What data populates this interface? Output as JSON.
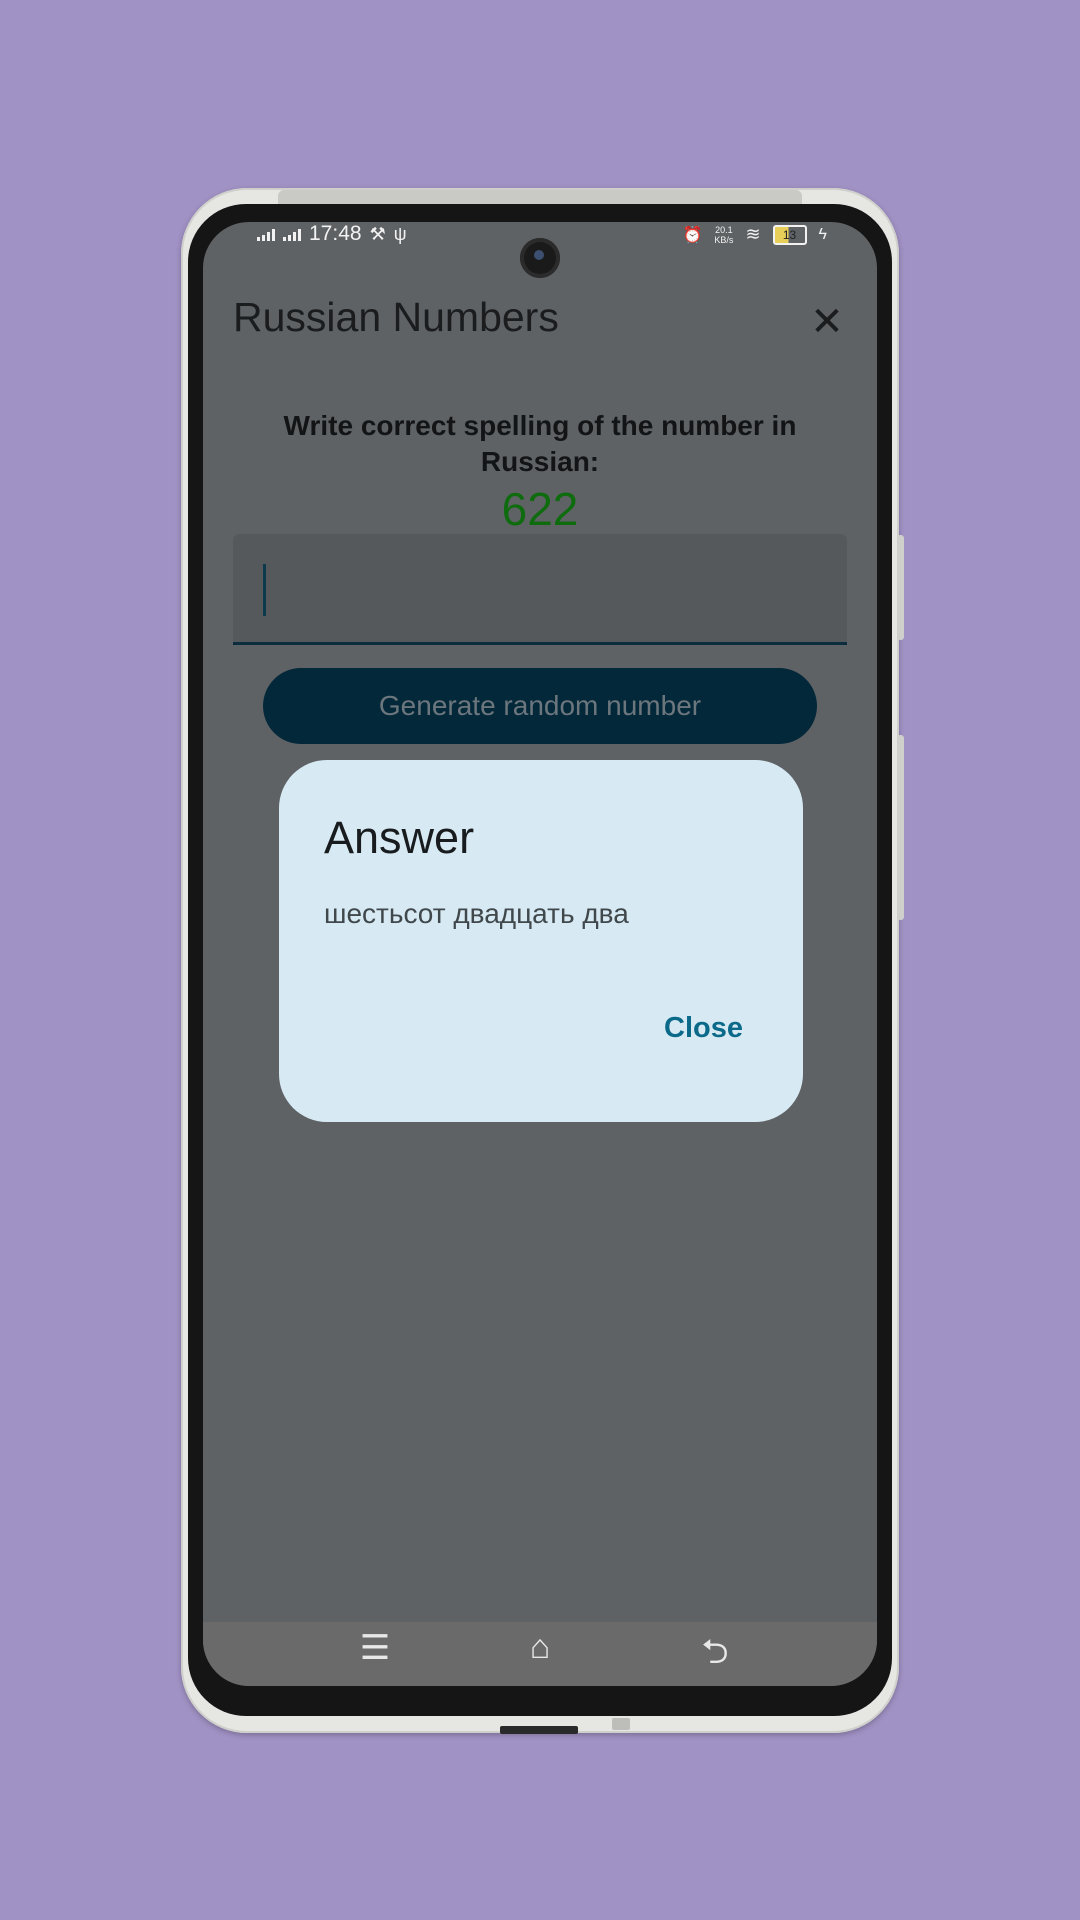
{
  "status_bar": {
    "time": "17:48",
    "tools_glyph": "⚒",
    "usb_glyph": "ψ",
    "alarm_glyph": "⏰",
    "net_speed_value": "20.1",
    "net_speed_unit": "KB/s",
    "wifi_glyph": "≋",
    "battery_level": "13",
    "charging_glyph": "ϟ"
  },
  "app_bar": {
    "title": "Russian Numbers",
    "close_glyph": "✕"
  },
  "main": {
    "prompt": "Write correct spelling of the number in Russian:",
    "number": "622",
    "input_value": "",
    "generate_button": "Generate random number"
  },
  "dialog": {
    "title": "Answer",
    "body": "шестьсот двадцать два",
    "close_button": "Close"
  },
  "nav_bar": {
    "menu_glyph": "☰",
    "home_glyph": "⌂",
    "back_glyph": "⮌"
  },
  "colors": {
    "background": "#a192c5",
    "screen_scrim": "#5f6265",
    "number": "#0e6b0e",
    "button": "#03283a",
    "dialog": "#d7eaf3",
    "dialog_action": "#0b6a8a"
  }
}
